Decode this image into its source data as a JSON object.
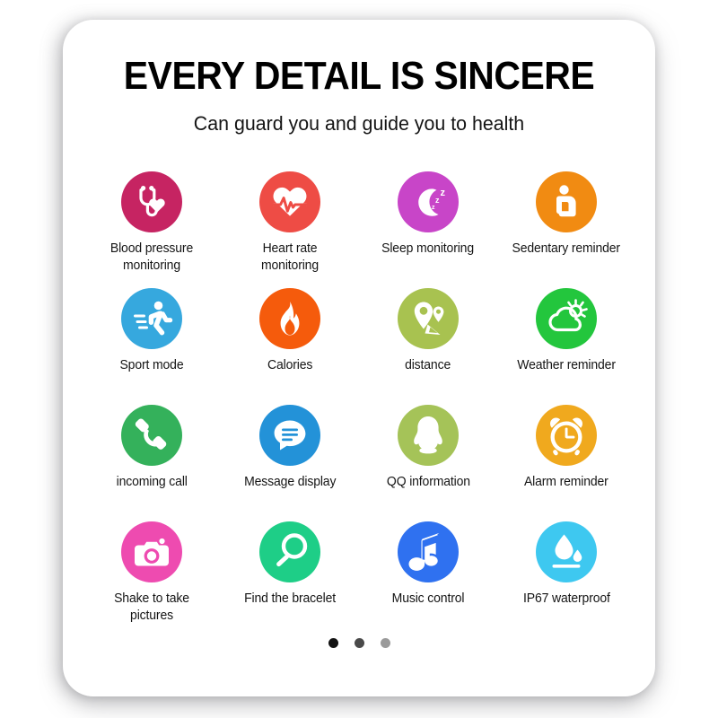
{
  "card": {
    "title": "EVERY DETAIL IS SINCERE",
    "subtitle": "Can guard you and guide you to health"
  },
  "features": [
    {
      "label": "Blood pressure monitoring",
      "icon": "stethoscope-heart-icon",
      "color": "#C62462"
    },
    {
      "label": "Heart rate monitoring",
      "icon": "heart-pulse-icon",
      "color": "#EE4C45"
    },
    {
      "label": "Sleep monitoring",
      "icon": "moon-zzz-icon",
      "color": "#C845C8"
    },
    {
      "label": "Sedentary reminder",
      "icon": "sitting-person-icon",
      "color": "#F18B12"
    },
    {
      "label": "Sport mode",
      "icon": "running-person-icon",
      "color": "#36A8DE"
    },
    {
      "label": "Calories",
      "icon": "flame-icon",
      "color": "#F55B0C"
    },
    {
      "label": "distance",
      "icon": "map-pins-icon",
      "color": "#A8C250"
    },
    {
      "label": "Weather reminder",
      "icon": "sun-cloud-icon",
      "color": "#23C63D"
    },
    {
      "label": "incoming call",
      "icon": "phone-handset-icon",
      "color": "#34B15B"
    },
    {
      "label": "Message display",
      "icon": "speech-bubble-icon",
      "color": "#2392D8"
    },
    {
      "label": "QQ information",
      "icon": "qq-penguin-icon",
      "color": "#A5C358"
    },
    {
      "label": "Alarm reminder",
      "icon": "alarm-clock-icon",
      "color": "#F0A91E"
    },
    {
      "label": "Shake to take pictures",
      "icon": "camera-icon",
      "color": "#EE4BB0"
    },
    {
      "label": "Find the bracelet",
      "icon": "magnifier-icon",
      "color": "#1ECE87"
    },
    {
      "label": "Music control",
      "icon": "music-note-icon",
      "color": "#2F71F0"
    },
    {
      "label": "IP67 waterproof",
      "icon": "water-drop-icon",
      "color": "#3EC8F0"
    }
  ],
  "pagination": {
    "dots": [
      {
        "state": "active",
        "color": "#121212"
      },
      {
        "state": "inactive",
        "color": "#4A4A4A"
      },
      {
        "state": "inactive",
        "color": "#9A9A9A"
      }
    ]
  }
}
